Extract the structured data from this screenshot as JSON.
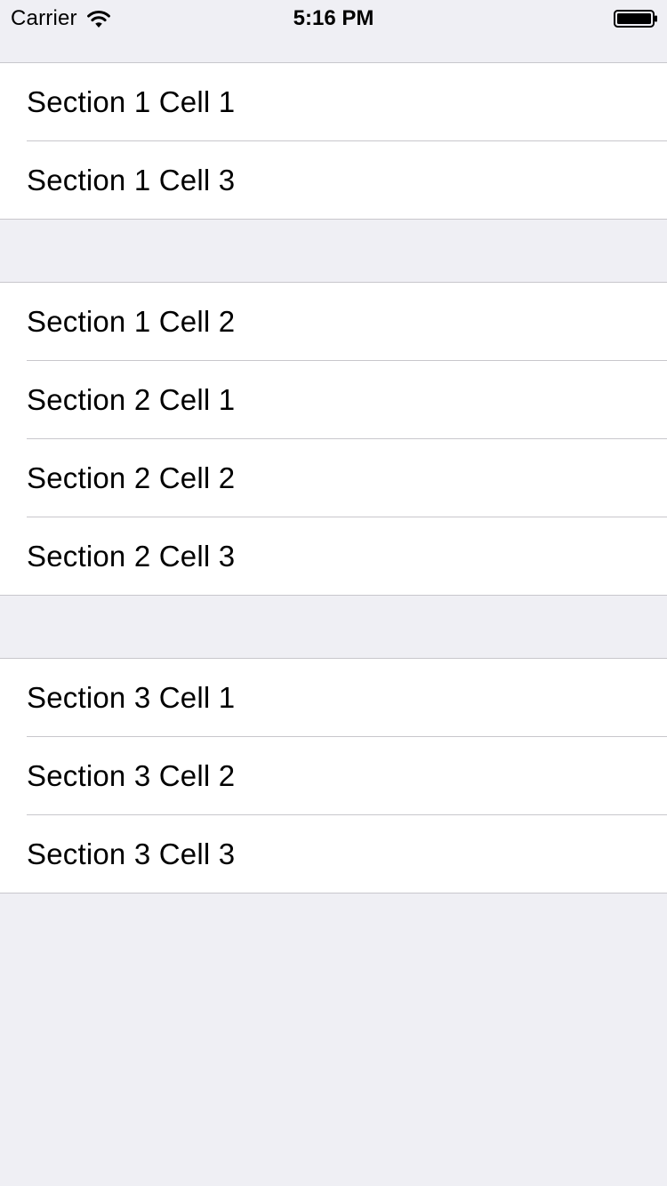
{
  "status_bar": {
    "carrier": "Carrier",
    "time": "5:16 PM",
    "wifi_icon": "wifi-icon",
    "battery_icon": "battery-icon"
  },
  "colors": {
    "background": "#efeff4",
    "cell_background": "#ffffff",
    "separator": "#c8c7cc",
    "text": "#000000"
  },
  "table": {
    "sections": [
      {
        "cells": [
          {
            "label": "Section 1 Cell 1"
          },
          {
            "label": "Section 1 Cell 3"
          }
        ]
      },
      {
        "cells": [
          {
            "label": "Section 1 Cell 2"
          },
          {
            "label": "Section 2 Cell 1"
          },
          {
            "label": "Section 2 Cell 2"
          },
          {
            "label": "Section 2 Cell 3"
          }
        ]
      },
      {
        "cells": [
          {
            "label": "Section 3 Cell 1"
          },
          {
            "label": "Section 3 Cell 2"
          },
          {
            "label": "Section 3 Cell 3"
          }
        ]
      }
    ]
  }
}
